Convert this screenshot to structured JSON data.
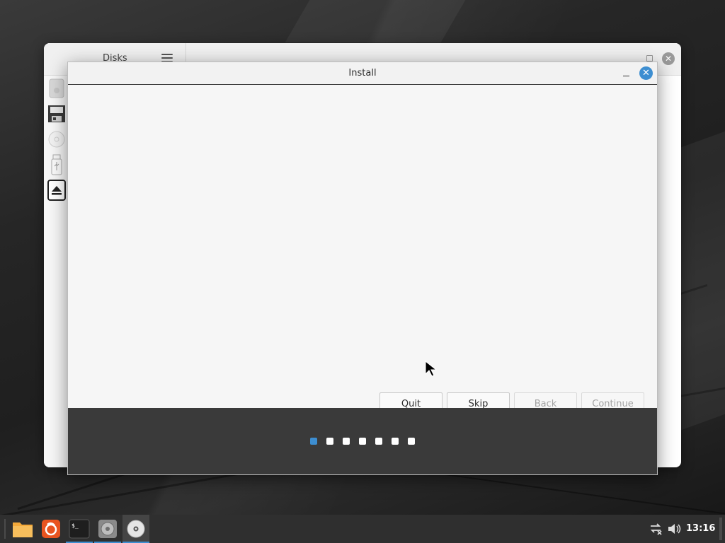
{
  "disks_window": {
    "title": "Disks"
  },
  "install_window": {
    "title": "Install",
    "minimize_glyph": "–",
    "close_glyph": "✕",
    "buttons": {
      "quit": "Quit",
      "skip": "Skip",
      "back": "Back",
      "continue": "Continue"
    },
    "progress": {
      "total_steps": 7,
      "current_step": 1
    }
  },
  "taskbar": {
    "apps": [
      {
        "name": "files",
        "icon": "folder-icon"
      },
      {
        "name": "firefox",
        "icon": "firefox-icon"
      },
      {
        "name": "terminal",
        "icon": "terminal-icon"
      },
      {
        "name": "disks",
        "icon": "disks-icon"
      },
      {
        "name": "install",
        "icon": "cd-icon"
      }
    ],
    "tray": {
      "network_icon": "network-disconnected-icon",
      "volume_icon": "volume-icon",
      "clock": "13:16"
    }
  },
  "colors": {
    "accent": "#3d8ed1",
    "footer": "#3a3a3a",
    "taskbar": "#2f2f2f"
  }
}
